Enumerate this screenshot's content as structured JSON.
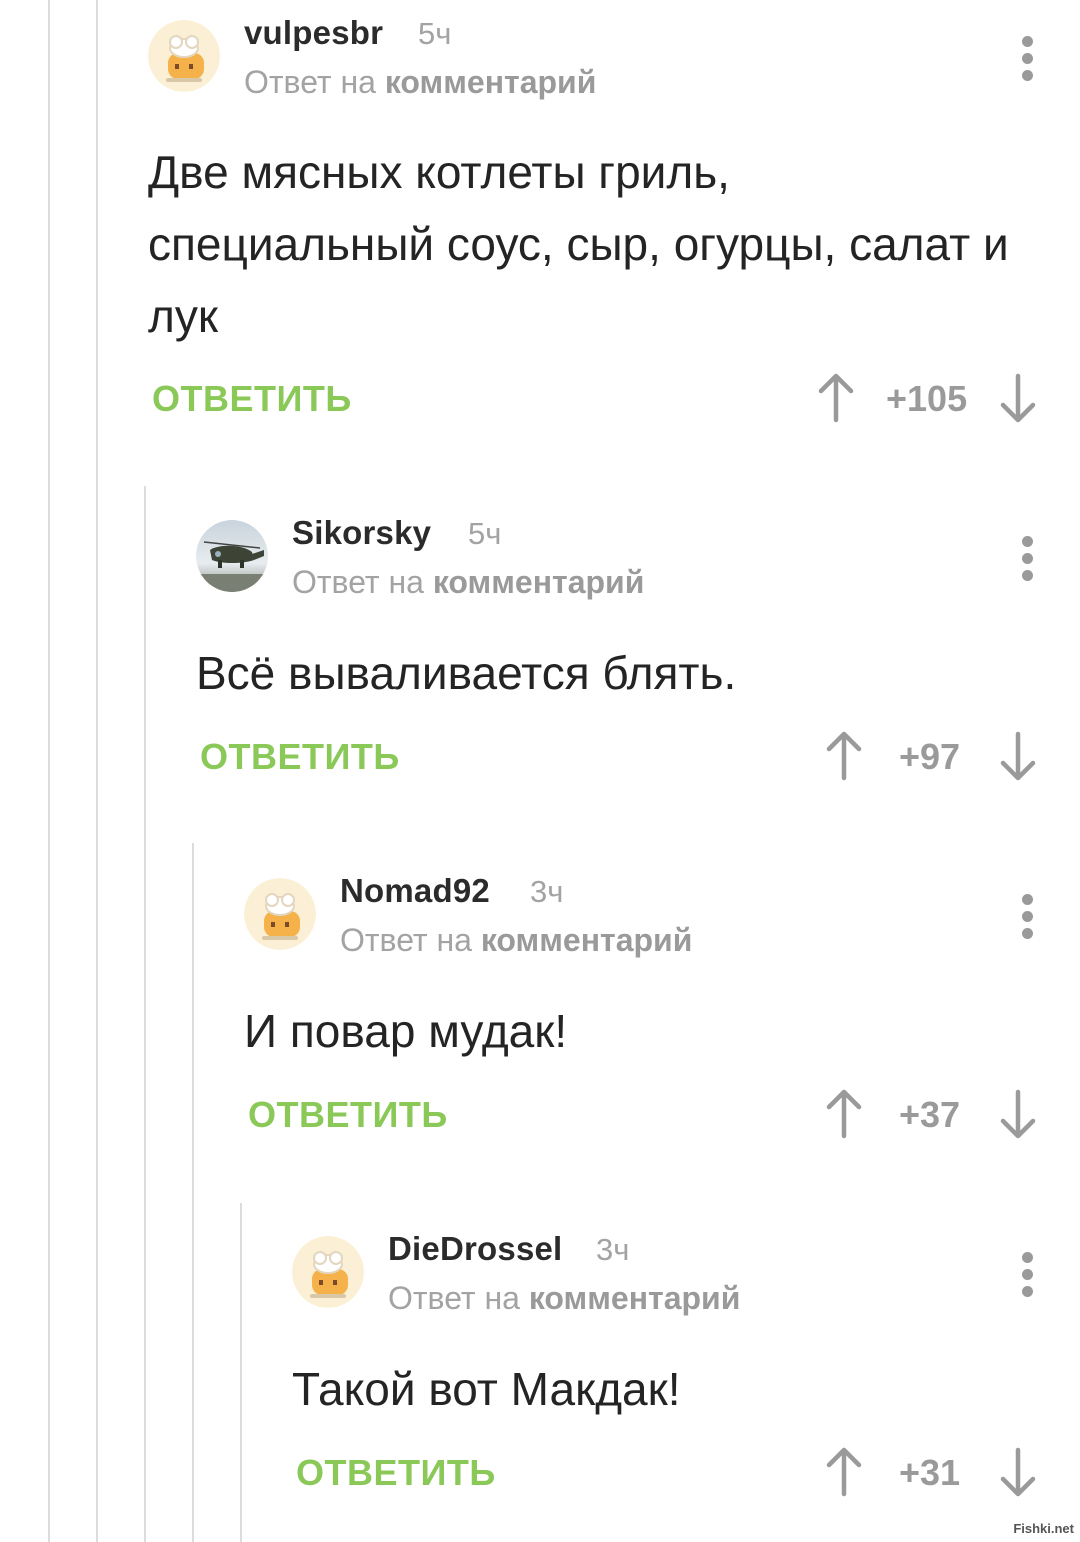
{
  "comments": [
    {
      "author": "vulpesbr",
      "time": "5ч",
      "reply_prefix": "Ответ на",
      "reply_link": "комментарий",
      "text": "Две мясных котлеты гриль, специальный соус, сыр, огурцы, салат и лук",
      "reply_label": "ОТВЕТИТЬ",
      "score": "+105",
      "avatar": "default-avatar-icon"
    },
    {
      "author": "Sikorsky",
      "time": "5ч",
      "reply_prefix": "Ответ на",
      "reply_link": "комментарий",
      "text": "Всё вываливается блять.",
      "reply_label": "ОТВЕТИТЬ",
      "score": "+97",
      "avatar": "helicopter-avatar"
    },
    {
      "author": "Nomad92",
      "time": "3ч",
      "reply_prefix": "Ответ на",
      "reply_link": "комментарий",
      "text": "И повар мудак!",
      "reply_label": "ОТВЕТИТЬ",
      "score": "+37",
      "avatar": "default-avatar-icon"
    },
    {
      "author": "DieDrossel",
      "time": "3ч",
      "reply_prefix": "Ответ на",
      "reply_link": "комментарий",
      "text": "Такой вот Макдак!",
      "reply_label": "ОТВЕТИТЬ",
      "score": "+31",
      "avatar": "default-avatar-icon"
    }
  ],
  "colors": {
    "accent_green": "#8ac858",
    "muted_gray": "#a3a3a3",
    "thread_line": "#dcdcdc"
  },
  "watermark": "Fishki.net"
}
